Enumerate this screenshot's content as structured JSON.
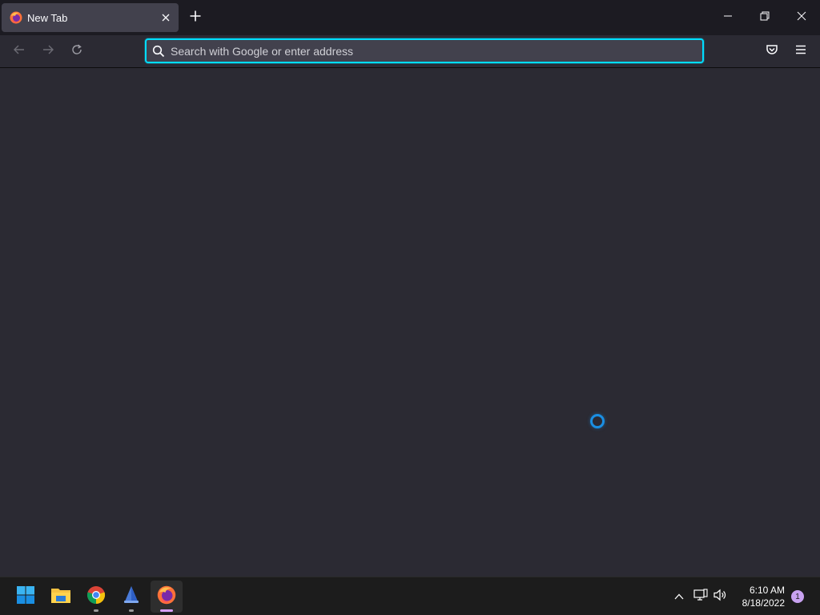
{
  "browser": {
    "tab": {
      "title": "New Tab",
      "favicon": "firefox-icon"
    },
    "window_controls": [
      "minimize-icon",
      "restore-icon",
      "close-icon"
    ],
    "urlbar": {
      "value": "",
      "placeholder": "Search with Google or enter address"
    },
    "toolbar_icons": [
      "back-arrow-icon",
      "forward-arrow-icon",
      "reload-icon",
      "pocket-icon",
      "hamburger-menu-icon"
    ]
  },
  "content": {
    "state": "loading"
  },
  "taskbar": {
    "apps": [
      {
        "name": "start",
        "icon": "windows-start-icon",
        "running": false
      },
      {
        "name": "file-explorer",
        "icon": "folder-icon",
        "running": false
      },
      {
        "name": "chrome",
        "icon": "chrome-icon",
        "running": true
      },
      {
        "name": "app",
        "icon": "blue-app-icon",
        "running": true
      },
      {
        "name": "firefox",
        "icon": "firefox-icon",
        "running": true,
        "active": true
      }
    ],
    "tray": {
      "time": "6:10 AM",
      "date": "8/18/2022",
      "notifications": "1"
    }
  },
  "colors": {
    "tabstrip_bg": "#1c1b22",
    "toolbar_bg": "#2b2a33",
    "tab_selected_bg": "#42414d",
    "urlbar_focus_border": "#00ddff",
    "spinner": "#1a8fe3",
    "taskbar_bg": "#1c1c1c",
    "active_indicator": "#d8a0ff"
  }
}
